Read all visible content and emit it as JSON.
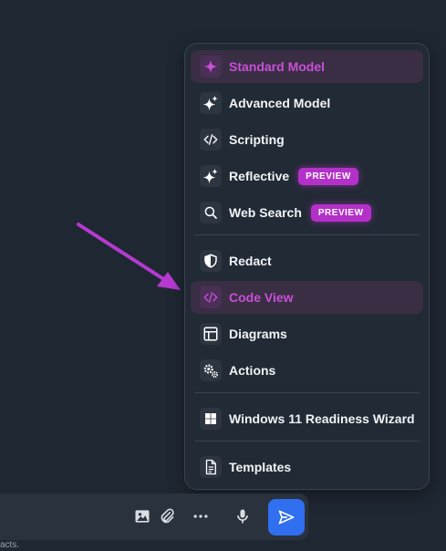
{
  "menu": {
    "groups": [
      [
        {
          "key": "standard",
          "label": "Standard Model",
          "icon": "sparkle-icon",
          "active": true
        },
        {
          "key": "advanced",
          "label": "Advanced Model",
          "icon": "sparkles-icon"
        },
        {
          "key": "scripting",
          "label": "Scripting",
          "icon": "code-icon"
        },
        {
          "key": "reflective",
          "label": "Reflective",
          "icon": "sparkles-icon",
          "badge": "PREVIEW"
        },
        {
          "key": "websearch",
          "label": "Web Search",
          "icon": "search-icon",
          "badge": "PREVIEW"
        }
      ],
      [
        {
          "key": "redact",
          "label": "Redact",
          "icon": "shield-icon"
        },
        {
          "key": "codeview",
          "label": "Code View",
          "icon": "code-icon",
          "active": true
        },
        {
          "key": "diagrams",
          "label": "Diagrams",
          "icon": "layout-icon"
        },
        {
          "key": "actions",
          "label": "Actions",
          "icon": "gears-icon"
        }
      ],
      [
        {
          "key": "windows",
          "label": "Windows 11 Readiness Wizard",
          "icon": "windows-icon"
        }
      ],
      [
        {
          "key": "templates",
          "label": "Templates",
          "icon": "document-icon"
        }
      ]
    ]
  },
  "composer": {
    "tools": [
      "image-icon",
      "paperclip-icon",
      "more-icon",
      "microphone-icon"
    ],
    "send_icon": "send-icon"
  },
  "footnote": "acts.",
  "colors": {
    "accent": "#c94fd8",
    "badge": "#b431c9",
    "send": "#2f6ff0",
    "arrow": "#b53ad1"
  }
}
